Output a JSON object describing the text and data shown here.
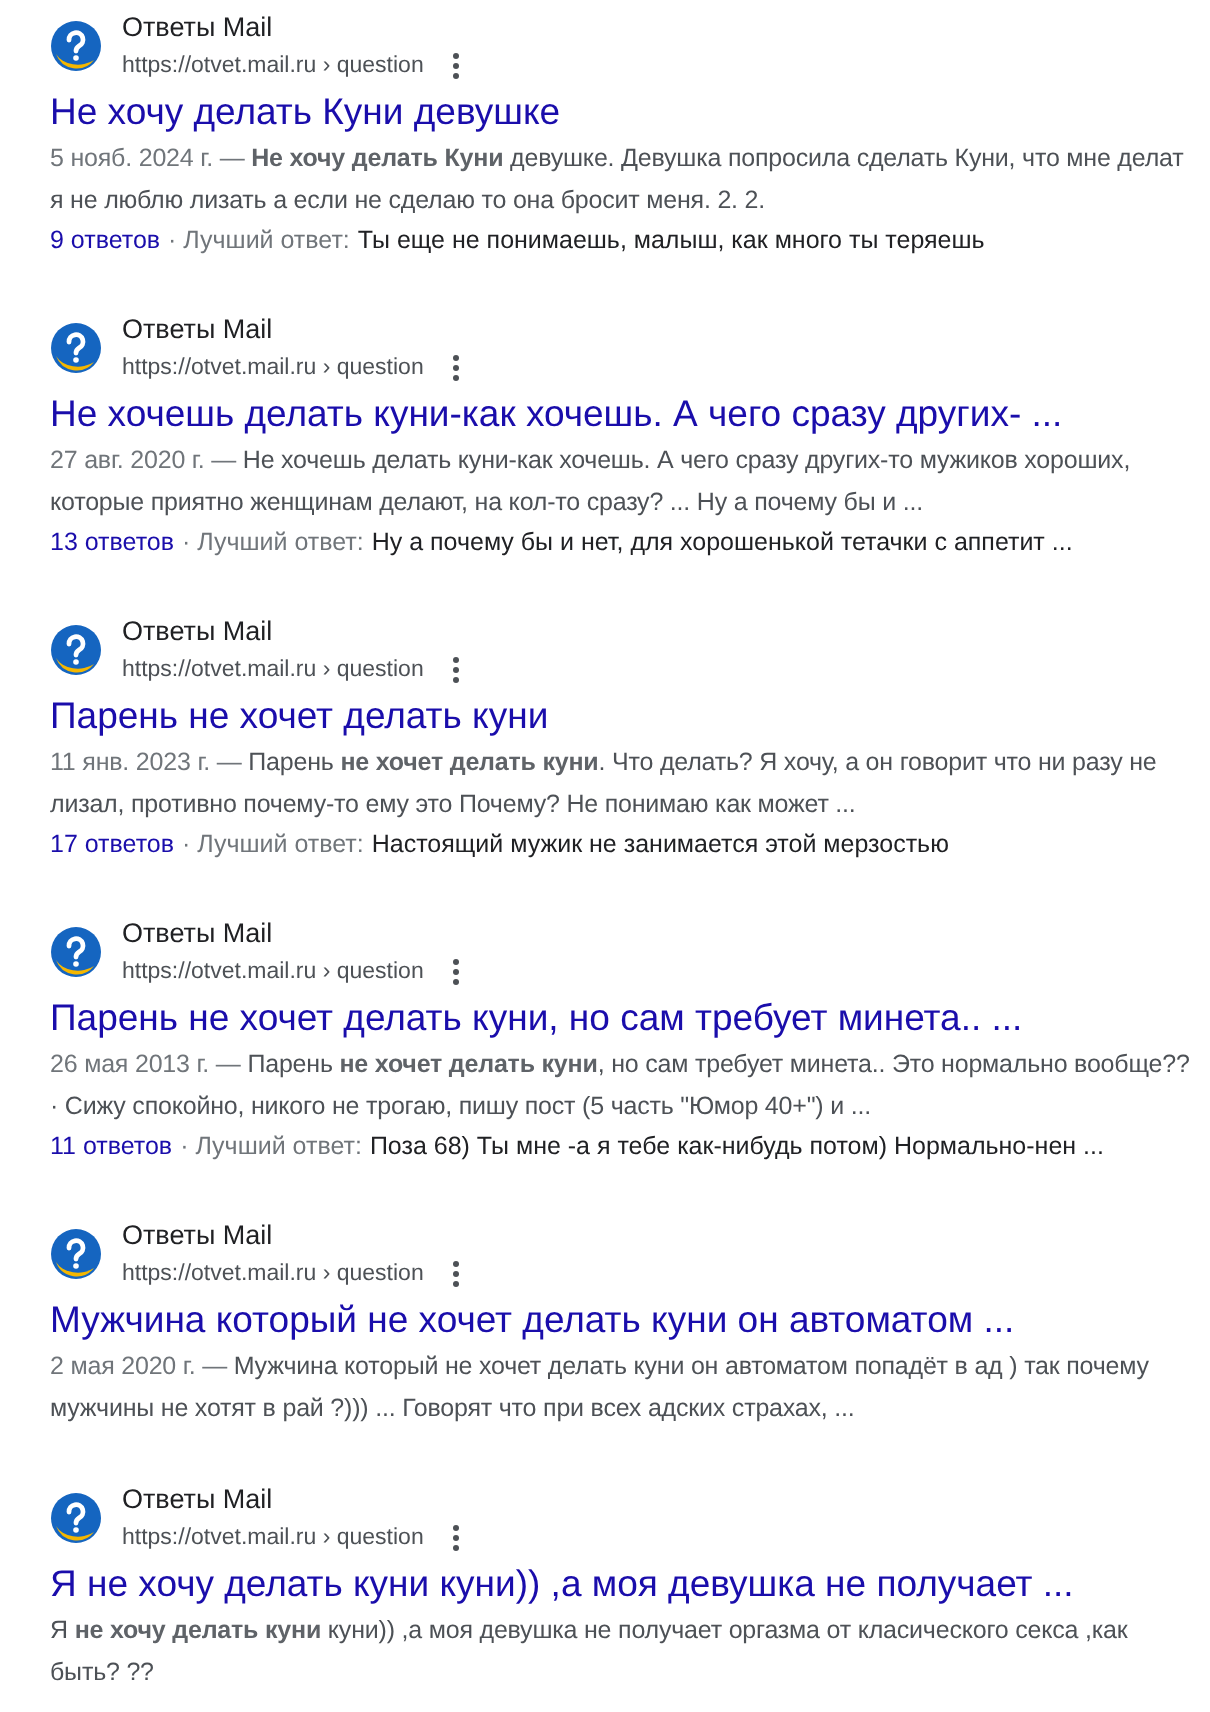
{
  "results": [
    {
      "site": "Ответы Mail",
      "url": "https://otvet.mail.ru › question",
      "title": "Не хочу делать Куни девушке",
      "date": "5 нояб. 2024 г. —",
      "snippet_lines": [
        "**Не хочу делать Куни** девушке. Девушка попросила сделать Куни, что мне делат",
        "я не люблю лизать а если не сделаю то она бросит меня. 2. 2."
      ],
      "answers": {
        "count": "9 ответов",
        "label": "· Лучший ответ:",
        "text": "Ты еще не понимаешь, малыш, как много ты теряешь"
      }
    },
    {
      "site": "Ответы Mail",
      "url": "https://otvet.mail.ru › question",
      "title": "Не хочешь делать куни-как хочешь. А чего сразу других- ...",
      "date": "27 авг. 2020 г. —",
      "snippet_lines": [
        "Не хочешь делать куни-как хочешь. А чего сразу других-то мужиков хороших,",
        "которые приятно женщинам делают, на кол-то сразу? ... Ну а почему бы и ..."
      ],
      "answers": {
        "count": "13 ответов",
        "label": "· Лучший ответ:",
        "text": "Ну а почему бы и нет, для хорошенькой тетачки с аппетит ..."
      }
    },
    {
      "site": "Ответы Mail",
      "url": "https://otvet.mail.ru › question",
      "title": "Парень не хочет делать куни",
      "date": "11 янв. 2023 г. —",
      "snippet_lines": [
        "Парень **не хочет делать куни**. Что делать? Я хочу, а он говорит что ни разу не",
        "лизал, противно почему-то ему это Почему? Не понимаю как может ..."
      ],
      "answers": {
        "count": "17 ответов",
        "label": "· Лучший ответ:",
        "text": "Настоящий мужик не занимается этой мерзостью"
      }
    },
    {
      "site": "Ответы Mail",
      "url": "https://otvet.mail.ru › question",
      "title": "Парень не хочет делать куни, но сам требует минета.. ...",
      "date": "26 мая 2013 г. —",
      "snippet_lines": [
        "Парень **не хочет делать куни**, но сам требует минета.. Это нормально вообще??",
        "· Сижу спокойно, никого не трогаю, пишу пост (5 часть \"Юмор 40+\") и ..."
      ],
      "answers": {
        "count": "11 ответов",
        "label": "· Лучший ответ:",
        "text": "Поза 68) Ты мне -а я тебе как-нибудь потом) Нормально-нен ..."
      }
    },
    {
      "site": "Ответы Mail",
      "url": "https://otvet.mail.ru › question",
      "title": "Мужчина который не хочет делать куни он автоматом ...",
      "date": "2 мая 2020 г. —",
      "snippet_lines": [
        "Мужчина который не хочет делать куни он автоматом попадёт в ад ) так почему",
        "мужчины не хотят в рай ?))) ... Говорят что при всех адских страхах, ..."
      ]
    },
    {
      "site": "Ответы Mail",
      "url": "https://otvet.mail.ru › question",
      "title": "Я не хочу делать куни куни)) ,а моя девушка не получает ...",
      "snippet_lines": [
        "Я **не хочу делать куни** куни)) ,а моя девушка не получает оргазма от класического секса ,как",
        "быть? ??"
      ]
    }
  ]
}
